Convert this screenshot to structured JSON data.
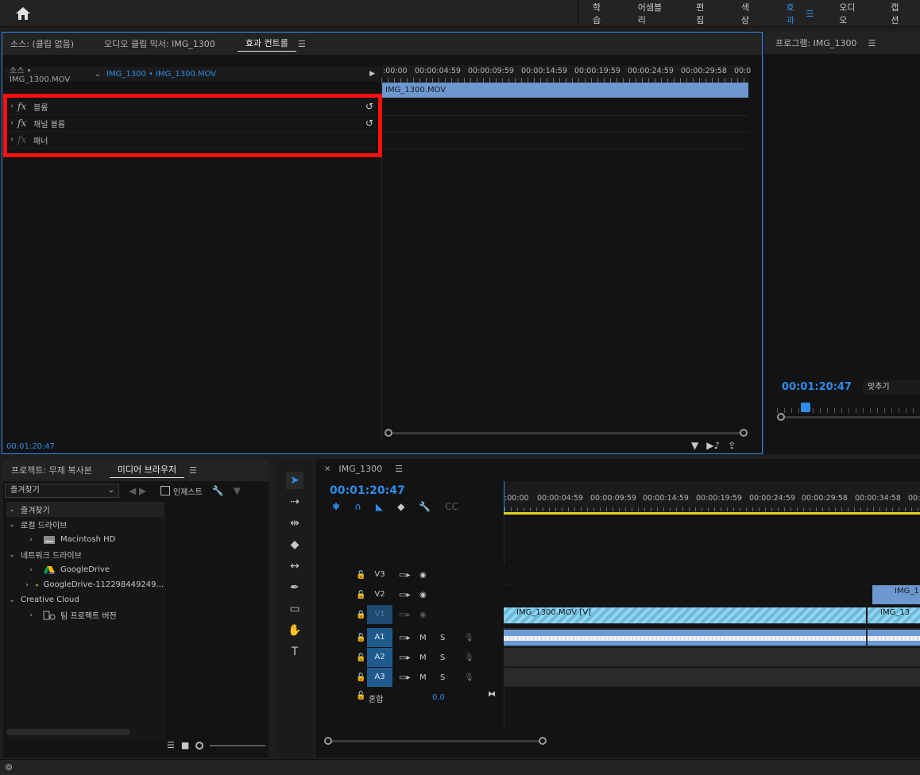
{
  "workspace": {
    "tabs": [
      "학습",
      "어셈블리",
      "편집",
      "색상",
      "효과",
      "오디오",
      "캡션"
    ],
    "active_tab": "효과"
  },
  "effect_panel": {
    "tabs": [
      "소스: (클립 없음)",
      "오디오 클립 믹서: IMG_1300",
      "효과 컨트롤"
    ],
    "source_label": "소스 • IMG_1300.MOV",
    "clip_label": "IMG_1300 • IMG_1300.MOV",
    "ruler_labels": [
      ":00:00",
      "00:00:04:59",
      "00:00:09:59",
      "00:00:14:59",
      "00:00:19:59",
      "00:00:24:59",
      "00:00:29:58",
      "00:0"
    ],
    "clip_name": "IMG_1300.MOV",
    "effects": [
      {
        "label": "볼륨",
        "reset": true,
        "enabled": true
      },
      {
        "label": "채널 볼륨",
        "reset": true,
        "enabled": true
      },
      {
        "label": "패너",
        "reset": false,
        "enabled": false
      }
    ],
    "timecode": "00:01:20:47"
  },
  "program_panel": {
    "title": "프로그램: IMG_1300",
    "timecode": "00:01:20:47",
    "fit": "맞추기"
  },
  "project_panel": {
    "tabs": [
      "프로젝트: 무제 복사본",
      "미디어 브라우저"
    ],
    "favorites_select": "즐겨찾기",
    "ingest_label": "인제스트",
    "tree": [
      {
        "label": "즐겨찾기",
        "level": 0,
        "expanded": true,
        "icon": ""
      },
      {
        "label": "로컬 드라이브",
        "level": 0,
        "expanded": true,
        "icon": ""
      },
      {
        "label": "Macintosh HD",
        "level": 1,
        "expanded": false,
        "icon": "hard-drive-icon"
      },
      {
        "label": "네트워크 드라이브",
        "level": 0,
        "expanded": true,
        "icon": ""
      },
      {
        "label": "GoogleDrive",
        "level": 1,
        "expanded": false,
        "icon": "google-drive-icon"
      },
      {
        "label": "GoogleDrive-112298449249...",
        "level": 1,
        "expanded": false,
        "icon": "google-drive-icon"
      },
      {
        "label": "Creative Cloud",
        "level": 0,
        "expanded": true,
        "icon": ""
      },
      {
        "label": "팀 프로젝트 버전",
        "level": 1,
        "expanded": false,
        "icon": "team-project-icon"
      }
    ]
  },
  "timeline": {
    "sequence_name": "IMG_1300",
    "timecode": "00:01:20:47",
    "ruler_labels": [
      ":00:00",
      "00:00:04:59",
      "00:00:09:59",
      "00:00:14:59",
      "00:00:19:59",
      "00:00:24:59",
      "00:00:29:58",
      "00:00:34:58",
      "00:"
    ],
    "tracks": [
      {
        "name": "V3",
        "type": "video"
      },
      {
        "name": "V2",
        "type": "video"
      },
      {
        "name": "V1",
        "type": "video"
      },
      {
        "name": "A1",
        "type": "audio"
      },
      {
        "name": "A2",
        "type": "audio"
      },
      {
        "name": "A3",
        "type": "audio"
      }
    ],
    "track_buttons": {
      "mute": "M",
      "solo": "S"
    },
    "mix_label": "혼합",
    "mix_value": "0.0",
    "v1_clip": "IMG_1300.MOV [V]",
    "v2_clip": "IMG_1",
    "v1_clip2": "IMG_13"
  }
}
